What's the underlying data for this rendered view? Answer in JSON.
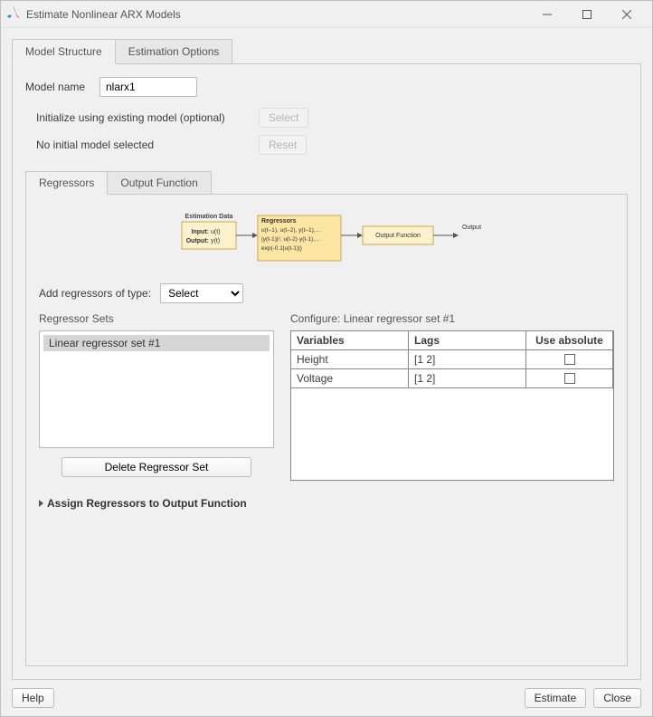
{
  "window": {
    "title": "Estimate Nonlinear ARX Models"
  },
  "top_tabs": {
    "model_structure": "Model Structure",
    "estimation_options": "Estimation Options"
  },
  "model_name": {
    "label": "Model name",
    "value": "nlarx1"
  },
  "init_model": {
    "label": "Initialize using existing model (optional)",
    "select_btn": "Select",
    "none_text": "No initial model selected",
    "reset_btn": "Reset"
  },
  "sub_tabs": {
    "regressors": "Regressors",
    "output_fn": "Output Function"
  },
  "diagram": {
    "est_title": "Estimation Data",
    "est_input_lbl": "Input:",
    "est_input_val": "u(t)",
    "est_output_lbl": "Output:",
    "est_output_val": "y(t)",
    "reg_title": "Regressors",
    "reg_line1": "u(t–1), u(t–2), y(t–1),…",
    "reg_line2": "|y(t-1)|², u(t-2)·y(t-1),…",
    "reg_line3": "exp(-0.1|u(t-1)|)",
    "out_fn": "Output Function",
    "out_lbl": "Output"
  },
  "add_regressors": {
    "label": "Add regressors of type:",
    "selected": "Select"
  },
  "regressor_sets": {
    "title": "Regressor Sets",
    "items": [
      "Linear regressor set #1"
    ],
    "delete_btn": "Delete Regressor Set"
  },
  "configure": {
    "title": "Configure: Linear regressor set #1",
    "headers": {
      "variables": "Variables",
      "lags": "Lags",
      "use_abs": "Use absolute"
    },
    "rows": [
      {
        "var": "Height",
        "lags": "[1 2]",
        "use_abs": false
      },
      {
        "var": "Voltage",
        "lags": "[1 2]",
        "use_abs": false
      }
    ]
  },
  "assign_label": "Assign Regressors to Output Function",
  "bottom": {
    "help": "Help",
    "estimate": "Estimate",
    "close": "Close"
  }
}
